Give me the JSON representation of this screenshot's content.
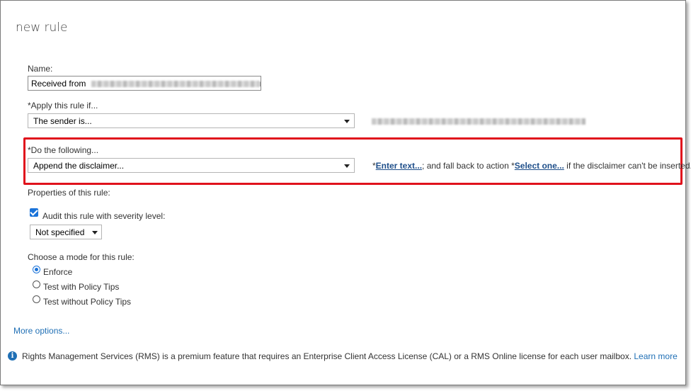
{
  "dialog": {
    "title": "new rule"
  },
  "name_field": {
    "label": "Name:",
    "value_prefix": "Received from"
  },
  "apply_rule": {
    "label": "*Apply this rule if...",
    "selected": "The sender is..."
  },
  "do_following": {
    "label": "*Do the following...",
    "selected": "Append the disclaimer...",
    "action_prefix": "*",
    "enter_text_link": "Enter text...",
    "middle_text": "; and fall back to action *",
    "select_one_link": "Select one...",
    "suffix_text": " if the disclaimer can't be inserted."
  },
  "properties": {
    "label": "Properties of this rule:",
    "audit_label": "Audit this rule with severity level:",
    "audit_checked": true,
    "severity_selected": "Not specified"
  },
  "mode": {
    "label": "Choose a mode for this rule:",
    "options": [
      "Enforce",
      "Test with Policy Tips",
      "Test without Policy Tips"
    ],
    "selected": "Enforce"
  },
  "more_options": "More options...",
  "footer": {
    "notice": "Rights Management Services (RMS) is a premium feature that requires an Enterprise Client Access License (CAL) or a RMS Online license for each user mailbox.",
    "learn_more": "Learn more"
  },
  "colors": {
    "highlight": "#e0121c",
    "link": "#1f6fb5",
    "accent": "#1a73d9"
  },
  "icons": {
    "info": "info-icon",
    "dropdown": "chevron-down-icon"
  }
}
